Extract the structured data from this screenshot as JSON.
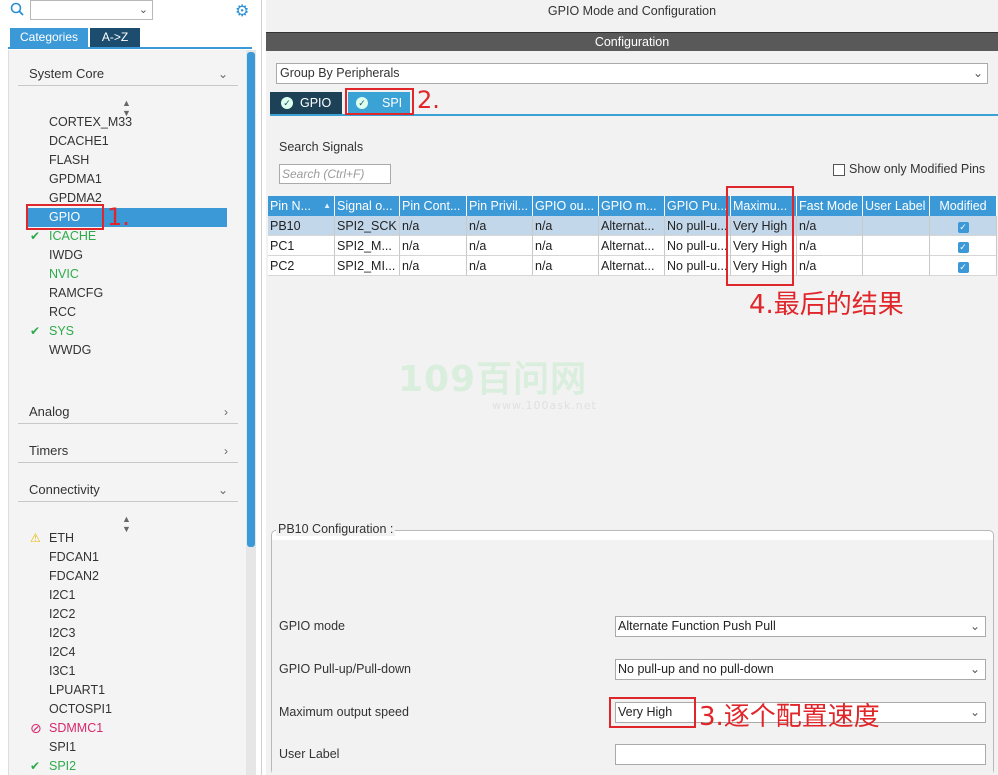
{
  "app": {
    "title": "GPIO Mode and Configuration"
  },
  "left": {
    "tabs": [
      "Categories",
      "A->Z"
    ],
    "categories": [
      {
        "name": "System Core",
        "state": "expanded"
      },
      {
        "name": "Analog",
        "state": "collapsed"
      },
      {
        "name": "Timers",
        "state": "collapsed"
      },
      {
        "name": "Connectivity",
        "state": "expanded"
      }
    ],
    "system_core_items": [
      {
        "label": "CORTEX_M33",
        "mark": ""
      },
      {
        "label": "DCACHE1",
        "mark": ""
      },
      {
        "label": "FLASH",
        "mark": ""
      },
      {
        "label": "GPDMA1",
        "mark": ""
      },
      {
        "label": "GPDMA2",
        "mark": ""
      },
      {
        "label": "GPIO",
        "mark": "selected"
      },
      {
        "label": "ICACHE",
        "mark": "check"
      },
      {
        "label": "IWDG",
        "mark": ""
      },
      {
        "label": "NVIC",
        "mark": "green"
      },
      {
        "label": "RAMCFG",
        "mark": ""
      },
      {
        "label": "RCC",
        "mark": ""
      },
      {
        "label": "SYS",
        "mark": "check"
      },
      {
        "label": "WWDG",
        "mark": ""
      }
    ],
    "connectivity_items": [
      {
        "label": "ETH",
        "mark": "warning"
      },
      {
        "label": "FDCAN1",
        "mark": ""
      },
      {
        "label": "FDCAN2",
        "mark": ""
      },
      {
        "label": "I2C1",
        "mark": ""
      },
      {
        "label": "I2C2",
        "mark": ""
      },
      {
        "label": "I2C3",
        "mark": ""
      },
      {
        "label": "I2C4",
        "mark": ""
      },
      {
        "label": "I3C1",
        "mark": ""
      },
      {
        "label": "LPUART1",
        "mark": ""
      },
      {
        "label": "OCTOSPI1",
        "mark": ""
      },
      {
        "label": "SDMMC1",
        "mark": "disabled"
      },
      {
        "label": "SPI1",
        "mark": ""
      },
      {
        "label": "SPI2",
        "mark": "check"
      }
    ]
  },
  "right": {
    "config_header": "Configuration",
    "group_by": "Group By Peripherals",
    "periph_tabs": [
      "GPIO",
      "SPI"
    ],
    "search_label": "Search Signals",
    "search_placeholder": "Search (Ctrl+F)",
    "show_modified_label": "Show only Modified Pins",
    "columns": [
      "Pin N...",
      "Signal o...",
      "Pin Cont...",
      "Pin Privil...",
      "GPIO ou...",
      "GPIO m...",
      "GPIO Pu...",
      "Maximu...",
      "Fast Mode",
      "User Label",
      "Modified"
    ],
    "rows": [
      [
        "PB10",
        "SPI2_SCK",
        "n/a",
        "n/a",
        "n/a",
        "Alternat...",
        "No pull-u...",
        "Very High",
        "n/a",
        "",
        ""
      ],
      [
        "PC1",
        "SPI2_M...",
        "n/a",
        "n/a",
        "n/a",
        "Alternat...",
        "No pull-u...",
        "Very High",
        "n/a",
        "",
        ""
      ],
      [
        "PC2",
        "SPI2_MI...",
        "n/a",
        "n/a",
        "n/a",
        "Alternat...",
        "No pull-u...",
        "Very High",
        "n/a",
        "",
        ""
      ]
    ],
    "pin_config_title": "PB10 Configuration :",
    "fields": [
      {
        "label": "GPIO mode",
        "value": "Alternate Function Push Pull"
      },
      {
        "label": "GPIO Pull-up/Pull-down",
        "value": "No pull-up and no pull-down"
      },
      {
        "label": "Maximum output speed",
        "value": "Very High"
      },
      {
        "label": "User Label",
        "value": ""
      }
    ]
  },
  "annotations": {
    "a1": "1.",
    "a2": "2.",
    "a3": "3.逐个配置速度",
    "a4": "4.最后的结果"
  },
  "watermark": {
    "text": "109百问网",
    "url": "www.100ask.net"
  },
  "colors": {
    "accent": "#3b99d8",
    "dark_tab": "#1d4257",
    "annotation": "#e0262a",
    "check": "#2eaa4a"
  }
}
